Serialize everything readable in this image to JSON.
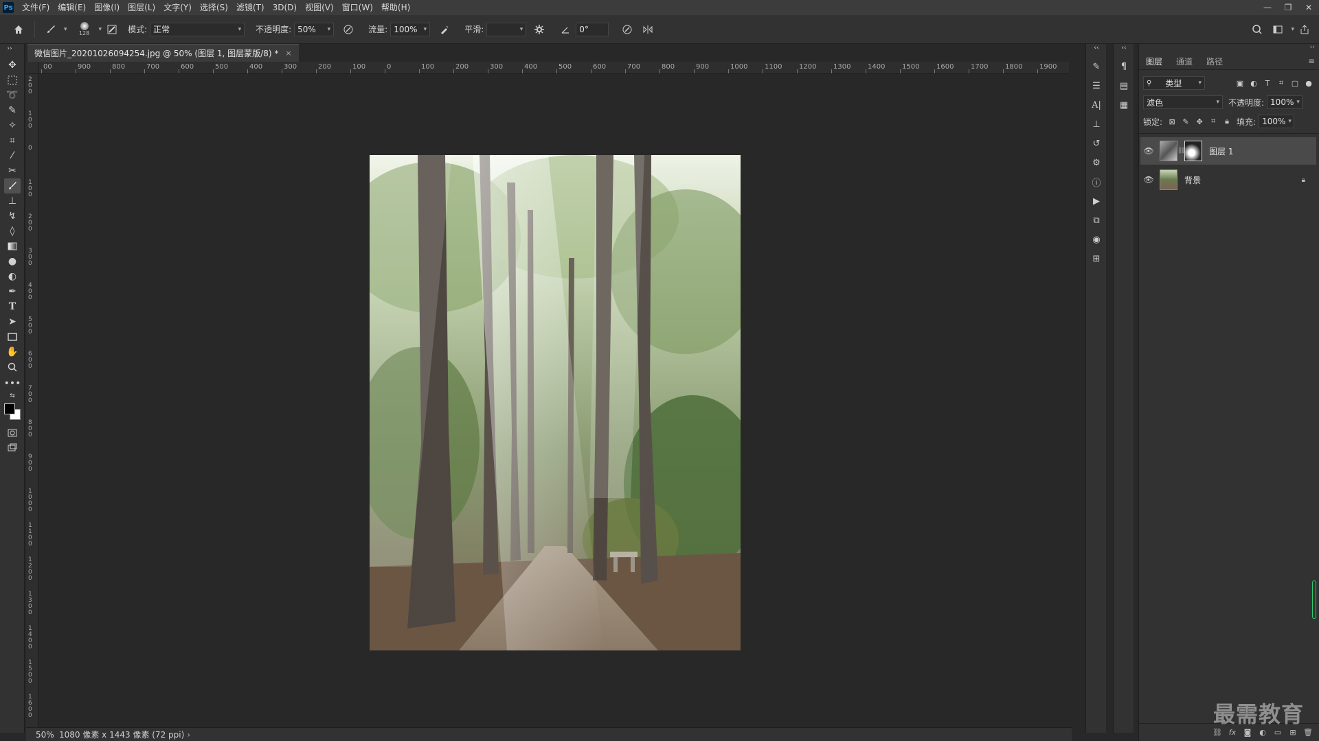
{
  "menubar": {
    "logo": "Ps",
    "items": [
      "文件(F)",
      "编辑(E)",
      "图像(I)",
      "图层(L)",
      "文字(Y)",
      "选择(S)",
      "滤镜(T)",
      "3D(D)",
      "视图(V)",
      "窗口(W)",
      "帮助(H)"
    ],
    "win_controls": [
      "—",
      "❐",
      "✕"
    ]
  },
  "options": {
    "brush_size": "128",
    "mode_label": "模式:",
    "mode_value": "正常",
    "opacity_label": "不透明度:",
    "opacity_value": "50%",
    "flow_label": "流量:",
    "flow_value": "100%",
    "smooth_label": "平滑:",
    "smooth_value": "",
    "angle_value": "0°"
  },
  "document": {
    "tab_title": "微信图片_20201026094254.jpg @ 50% (图层 1, 图层蒙版/8) *",
    "close": "×"
  },
  "ruler": {
    "h_labels": [
      "00",
      "900",
      "800",
      "700",
      "600",
      "500",
      "400",
      "300",
      "200",
      "100",
      "0",
      "100",
      "200",
      "300",
      "400",
      "500",
      "600",
      "700",
      "800",
      "900",
      "1000",
      "1100",
      "1200",
      "1300",
      "1400",
      "1500",
      "1600",
      "1700",
      "1800",
      "1900",
      "200"
    ],
    "v_labels": [
      "200",
      "100",
      "0",
      "100",
      "200",
      "300",
      "400",
      "500",
      "600",
      "700",
      "800",
      "900",
      "1000",
      "1100",
      "1200",
      "1300",
      "1400",
      "1500",
      "1600"
    ]
  },
  "status": {
    "zoom": "50%",
    "info": "1080 像素 x 1443 像素 (72 ppi)",
    "arrow": "›"
  },
  "layers_panel": {
    "tabs": [
      "图层",
      "通道",
      "路径"
    ],
    "filter_label": "类型",
    "blend_mode": "滤色",
    "opacity_label": "不透明度:",
    "opacity_value": "100%",
    "lock_label": "锁定:",
    "fill_label": "填充:",
    "fill_value": "100%",
    "layers": [
      {
        "name": "图层 1",
        "selected": true
      },
      {
        "name": "背景",
        "selected": false
      }
    ]
  },
  "watermark": "最需教育",
  "colors": {
    "accent": "#31a8ff",
    "panel": "#323232",
    "canvas": "#282828"
  }
}
